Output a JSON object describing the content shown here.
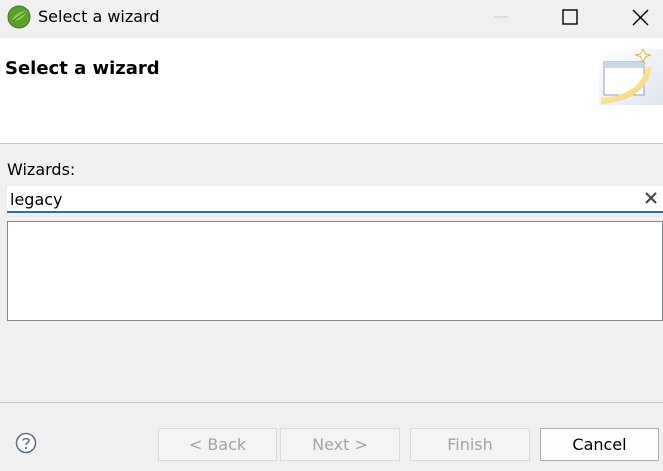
{
  "window": {
    "title": "Select a wizard"
  },
  "header": {
    "title": "Select a wizard"
  },
  "wizards": {
    "label": "Wizards:",
    "filter_value": "legacy",
    "items": []
  },
  "buttons": {
    "back": "< Back",
    "next": "Next >",
    "finish": "Finish",
    "cancel": "Cancel"
  },
  "colors": {
    "focus_underline": "#2f6db0",
    "disabled_text": "#a3a3a3",
    "app_icon_green": "#5aa02c"
  },
  "icons": {
    "app": "eclipse-spring-leaf-icon",
    "banner": "new-wizard-banner-icon",
    "clear": "clear-filter-icon",
    "help": "help-icon"
  }
}
